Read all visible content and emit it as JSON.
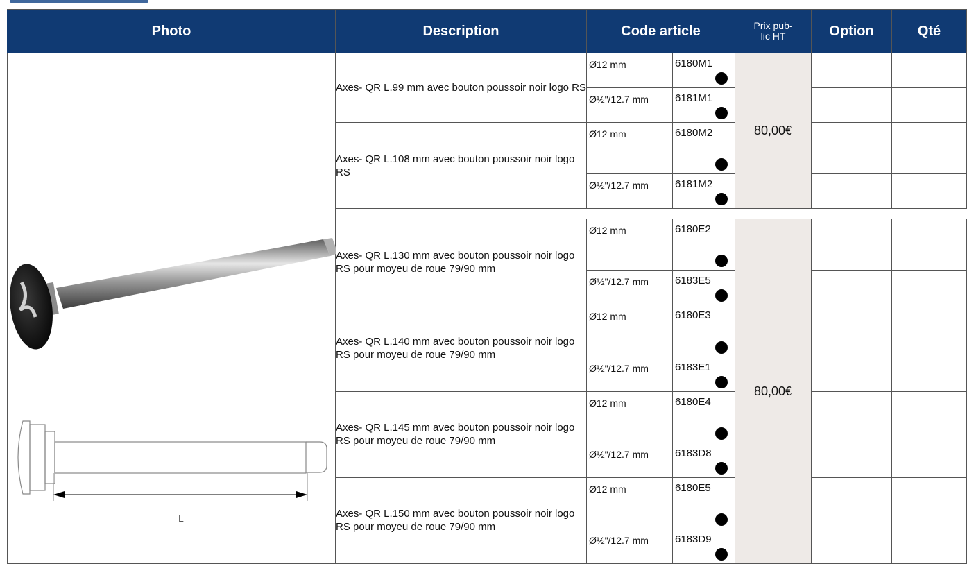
{
  "header": {
    "photo": "Photo",
    "description": "Description",
    "code_article": "Code article",
    "prix": "Prix pub-lic HT",
    "option": "Option",
    "qte": "Qté"
  },
  "drawing_label": "L",
  "group1": {
    "price": "80,00€",
    "items": [
      {
        "desc": "Axes- QR L.99 mm avec bouton poussoir noir logo RS",
        "variants": [
          {
            "dia": "Ø12 mm",
            "code": "6180M1"
          },
          {
            "dia": "Ø½\"/12.7 mm",
            "code": "6181M1"
          }
        ]
      },
      {
        "desc": "Axes- QR L.108 mm avec bouton poussoir noir logo RS",
        "variants": [
          {
            "dia": "Ø12 mm",
            "code": "6180M2"
          },
          {
            "dia": "Ø½\"/12.7 mm",
            "code": "6181M2"
          }
        ]
      }
    ]
  },
  "group2": {
    "price": "80,00€",
    "items": [
      {
        "desc": "Axes- QR L.130 mm avec bouton poussoir noir logo RS pour moyeu de roue 79/90 mm",
        "variants": [
          {
            "dia": "Ø12 mm",
            "code": "6180E2"
          },
          {
            "dia": "Ø½\"/12.7 mm",
            "code": "6183E5"
          }
        ]
      },
      {
        "desc": "Axes- QR L.140 mm avec bouton poussoir noir logo RS pour moyeu de roue 79/90 mm",
        "variants": [
          {
            "dia": "Ø12 mm",
            "code": "6180E3"
          },
          {
            "dia": "Ø½\"/12.7 mm",
            "code": "6183E1"
          }
        ]
      },
      {
        "desc": "Axes- QR L.145 mm avec bouton poussoir noir logo RS pour moyeu de roue 79/90 mm",
        "variants": [
          {
            "dia": "Ø12 mm",
            "code": "6180E4"
          },
          {
            "dia": "Ø½\"/12.7 mm",
            "code": "6183D8"
          }
        ]
      },
      {
        "desc": "Axes- QR L.150 mm avec bouton poussoir noir logo RS pour moyeu de roue 79/90 mm",
        "variants": [
          {
            "dia": "Ø12 mm",
            "code": "6180E5"
          },
          {
            "dia": "Ø½\"/12.7 mm",
            "code": "6183D9"
          }
        ]
      }
    ]
  },
  "colors": {
    "header_bg": "#103a73",
    "price_bg": "#eeeae7",
    "dot": "#000000"
  },
  "icons": [
    "axle-photo",
    "axle-drawing"
  ]
}
